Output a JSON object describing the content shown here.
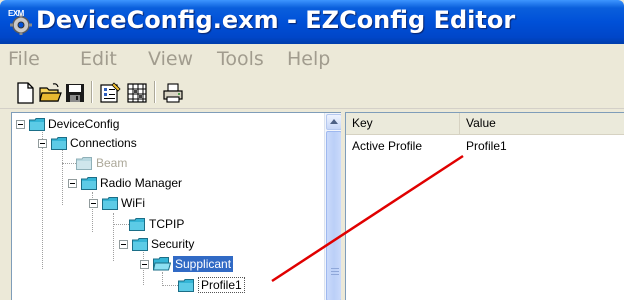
{
  "window": {
    "title": "DeviceConfig.exm - EZConfig Editor",
    "icon_badge": "EXM"
  },
  "menu": [
    "File",
    "Edit",
    "View",
    "Tools",
    "Help"
  ],
  "toolbar": {
    "buttons": [
      "new-document-icon",
      "open-folder-icon",
      "save-icon",
      "properties-icon",
      "grid-icon",
      "printer-icon"
    ]
  },
  "tree": {
    "nodes": [
      {
        "label": "DeviceConfig",
        "state": "expanded"
      },
      {
        "label": "Connections",
        "state": "expanded"
      },
      {
        "label": "Beam",
        "state": "disabled"
      },
      {
        "label": "Radio Manager",
        "state": "expanded"
      },
      {
        "label": "WiFi",
        "state": "expanded"
      },
      {
        "label": "TCPIP",
        "state": "leaf"
      },
      {
        "label": "Security",
        "state": "expanded"
      },
      {
        "label": "Supplicant",
        "state": "selected"
      },
      {
        "label": "Profile1",
        "state": "leaf"
      }
    ]
  },
  "list": {
    "columns": [
      "Key",
      "Value"
    ],
    "rows": [
      {
        "key": "Active Profile",
        "value": "Profile1"
      }
    ]
  },
  "colors": {
    "titlebar": "#0050d8",
    "selection": "#316ac5",
    "annotation_line": "#e00000",
    "folder": "#35b5d6"
  }
}
